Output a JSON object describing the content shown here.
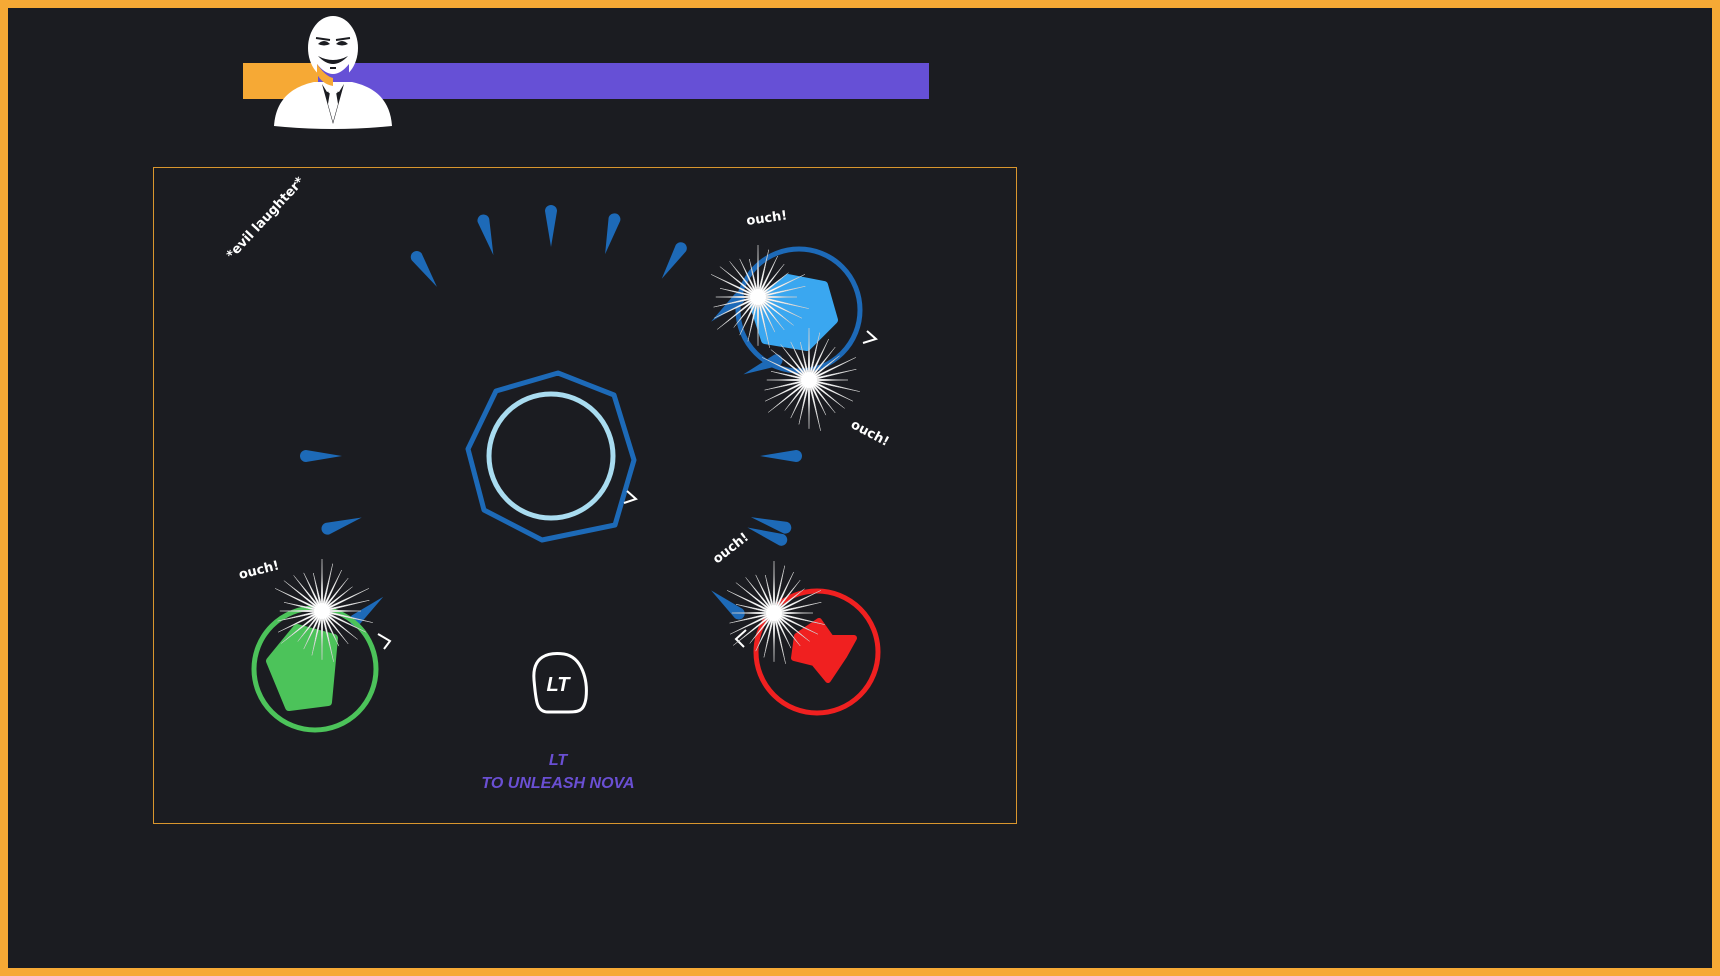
{
  "hud": {
    "boss_avatar_icon": "masked-villain-icon",
    "boss_health_fraction": 0.11,
    "colors": {
      "health_fill": "#f6a935",
      "health_track": "#6650d6"
    }
  },
  "arena": {
    "taunt": "*evil laughter*",
    "hit_labels": [
      "ouch!",
      "ouch!",
      "ouch!",
      "ouch!"
    ],
    "prompt": {
      "button": "LT",
      "key_label": "LT",
      "action": "TO UNLEASH NOVA"
    },
    "players": [
      {
        "color": "#3aa7f0",
        "shape": "hexagon"
      },
      {
        "color": "#4cc35a",
        "shape": "pentagon"
      },
      {
        "color": "#f02020",
        "shape": "star"
      }
    ],
    "colors": {
      "frame": "#f6a935",
      "nova_ring": "#1d6ab8",
      "core_ring": "#a9dcf0",
      "background": "#1b1c21"
    }
  }
}
